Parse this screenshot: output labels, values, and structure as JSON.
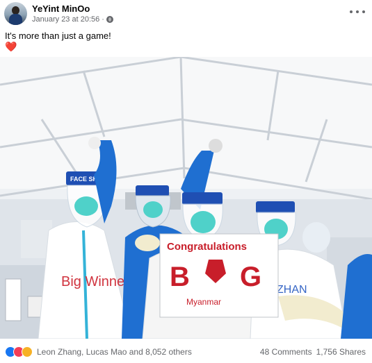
{
  "post": {
    "author": "YeYint MinOo",
    "timestamp": "January 23 at 20:56",
    "separator": "·",
    "privacy_icon": "globe-icon",
    "more_icon": "more-options-icon",
    "text": "It's more than just a game!",
    "emoji": "❤️"
  },
  "photo": {
    "banner_title": "Congratulations",
    "banner_letters": [
      "B",
      "G"
    ],
    "banner_subtitle": "Myanmar",
    "face_shield_label": "FACE SHIELD",
    "suit_text": "Big Winner",
    "suit_text_2": "ZHAN"
  },
  "footer": {
    "reactors": "Leon Zhang, Lucas Mao and 8,052 others",
    "comments": "48 Comments",
    "shares": "1,756 Shares",
    "reaction_icons": [
      "like-icon",
      "love-icon",
      "care-icon"
    ]
  },
  "colors": {
    "ppe_blue": "#1f6fd1",
    "visor_cyan": "#4fd1c9",
    "banner_red": "#c81e2a",
    "tent_white": "#f4f6f8"
  }
}
